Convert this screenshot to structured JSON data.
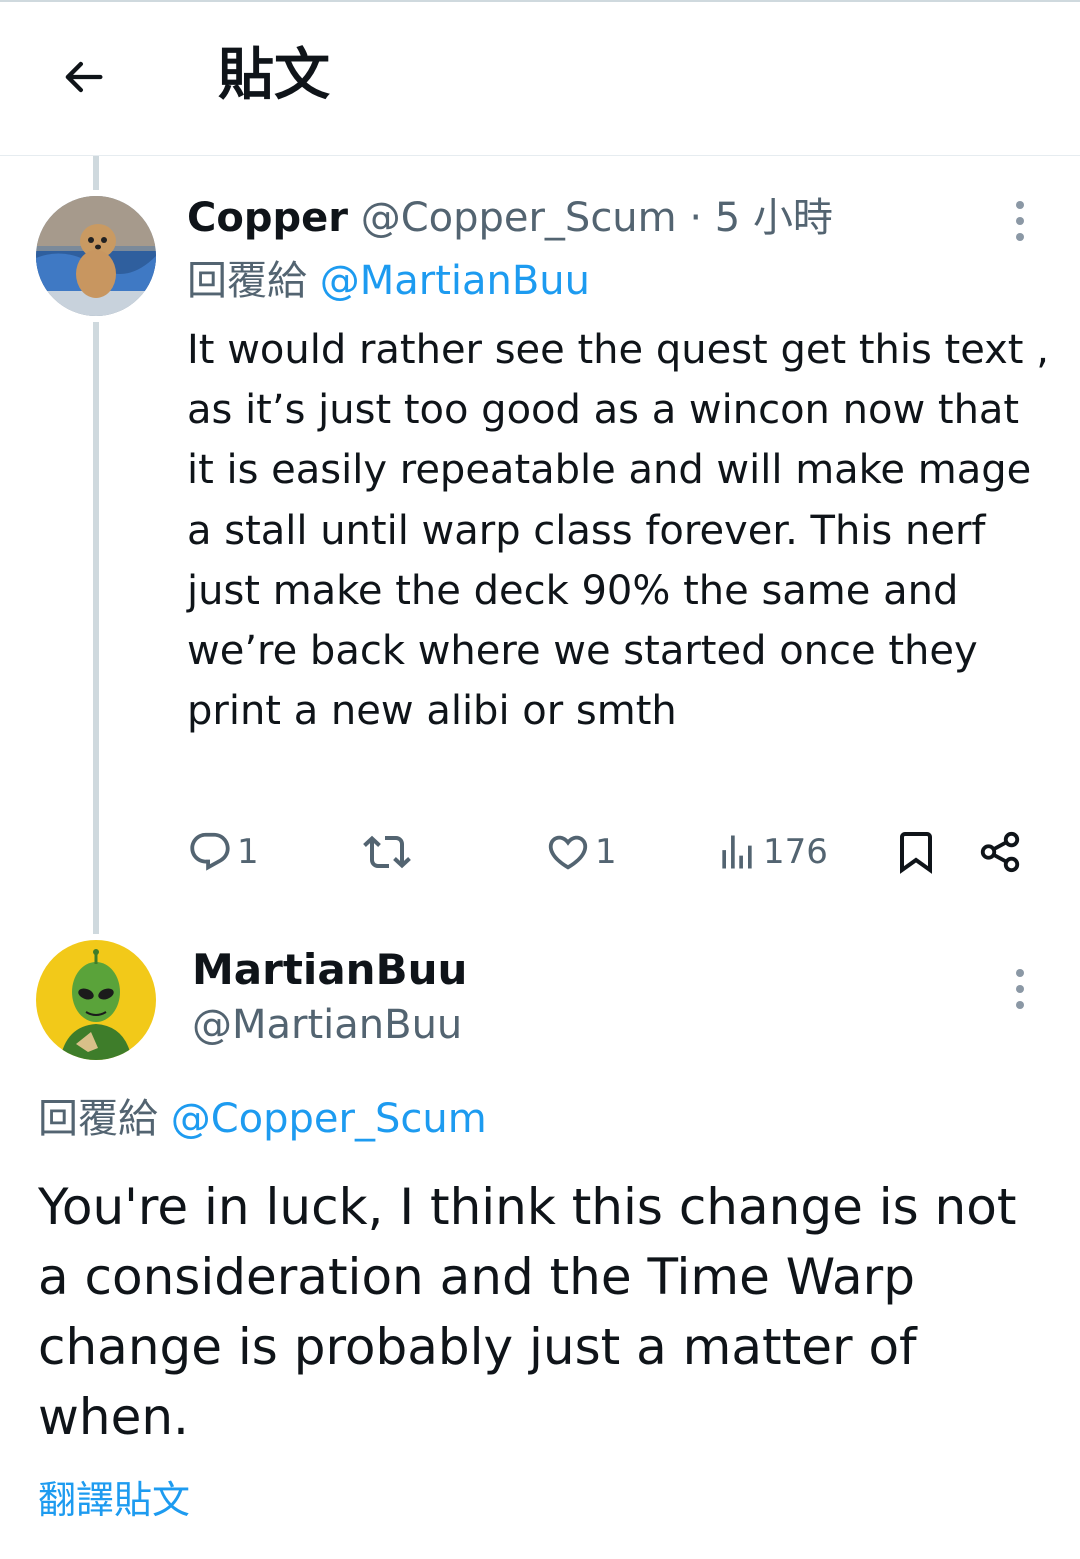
{
  "header": {
    "title": "貼文"
  },
  "parent": {
    "name": "Copper",
    "handle": "@Copper_Scum",
    "time": "· 5 小時",
    "reply_prefix": "回覆給",
    "reply_to": "@MartianBuu",
    "text": "It would rather see the quest get this text , as it’s just too good as a wincon now that it is easily repeatable and will make mage a stall until warp class forever. This nerf just make the deck 90% the same and we’re back where we started once they print a new alibi or smth",
    "stats": {
      "replies": "1",
      "reposts": "",
      "likes": "1",
      "views": "176"
    }
  },
  "main": {
    "name": "MartianBuu",
    "handle": "@MartianBuu",
    "reply_prefix": "回覆給",
    "reply_to": "@Copper_Scum",
    "text": "You're in luck, I think this change is not a consideration and the Time Warp change is probably just a matter of when.",
    "translate": "翻譯貼文"
  },
  "colors": {
    "link": "#1d9bf0",
    "muted": "#536471",
    "text": "#0f1419",
    "thread_line": "#cfd9de"
  },
  "icons": [
    "back-arrow-icon",
    "more-icon",
    "reply-icon",
    "repost-icon",
    "like-icon",
    "views-icon",
    "bookmark-icon",
    "share-icon"
  ]
}
